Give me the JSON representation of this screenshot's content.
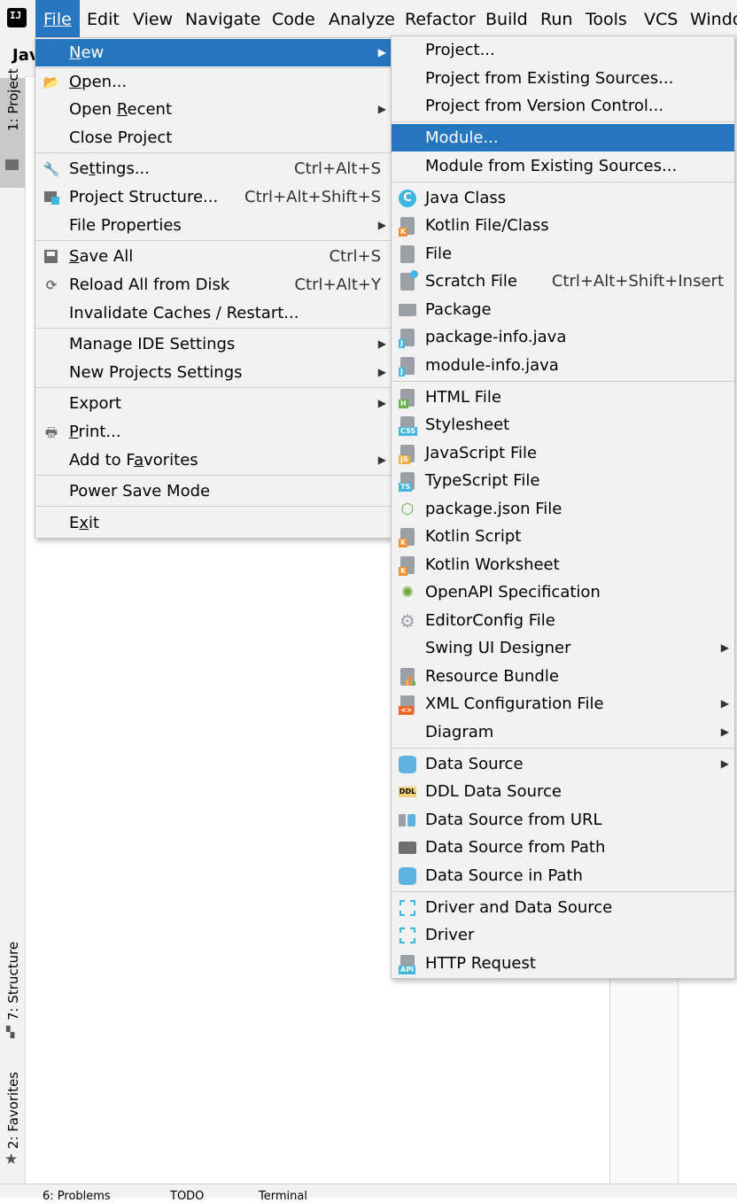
{
  "menubar": {
    "items": [
      "File",
      "Edit",
      "View",
      "Navigate",
      "Code",
      "Analyze",
      "Refactor",
      "Build",
      "Run",
      "Tools",
      "VCS",
      "Windo"
    ],
    "active": "File"
  },
  "toolbar": {
    "title": "Jav"
  },
  "left_stripe": {
    "project": "1: Project",
    "structure": "7: Structure",
    "favorites": "2: Favorites"
  },
  "bottom_bar": {
    "items": [
      "6: Problems",
      "TODO",
      "Terminal"
    ]
  },
  "file_menu": {
    "items": [
      {
        "label": "New",
        "submenu": true,
        "selected": true
      },
      {
        "label": "Open...",
        "icon": "folder-open-icon"
      },
      {
        "label": "Open Recent",
        "submenu": true
      },
      {
        "label": "Close Project"
      },
      {
        "label": "Settings...",
        "shortcut": "Ctrl+Alt+S",
        "icon": "wrench-icon"
      },
      {
        "label": "Project Structure...",
        "shortcut": "Ctrl+Alt+Shift+S",
        "icon": "project-structure-icon"
      },
      {
        "label": "File Properties",
        "submenu": true
      },
      {
        "label": "Save All",
        "shortcut": "Ctrl+S",
        "icon": "save-icon"
      },
      {
        "label": "Reload All from Disk",
        "shortcut": "Ctrl+Alt+Y",
        "icon": "reload-icon"
      },
      {
        "label": "Invalidate Caches / Restart..."
      },
      {
        "label": "Manage IDE Settings",
        "submenu": true
      },
      {
        "label": "New Projects Settings",
        "submenu": true
      },
      {
        "label": "Export",
        "submenu": true
      },
      {
        "label": "Print...",
        "icon": "printer-icon"
      },
      {
        "label": "Add to Favorites",
        "submenu": true
      },
      {
        "label": "Power Save Mode"
      },
      {
        "label": "Exit"
      }
    ]
  },
  "new_menu": {
    "items": [
      {
        "label": "Project..."
      },
      {
        "label": "Project from Existing Sources..."
      },
      {
        "label": "Project from Version Control..."
      },
      {
        "label": "Module...",
        "selected": true
      },
      {
        "label": "Module from Existing Sources..."
      },
      {
        "label": "Java Class",
        "icon": "java-class-icon"
      },
      {
        "label": "Kotlin File/Class",
        "icon": "kotlin-file-icon"
      },
      {
        "label": "File",
        "icon": "file-icon"
      },
      {
        "label": "Scratch File",
        "shortcut": "Ctrl+Alt+Shift+Insert",
        "icon": "scratch-file-icon"
      },
      {
        "label": "Package",
        "icon": "package-icon"
      },
      {
        "label": "package-info.java",
        "icon": "java-file-icon"
      },
      {
        "label": "module-info.java",
        "icon": "java-file-icon"
      },
      {
        "label": "HTML File",
        "icon": "html-file-icon"
      },
      {
        "label": "Stylesheet",
        "icon": "css-file-icon"
      },
      {
        "label": "JavaScript File",
        "icon": "js-file-icon"
      },
      {
        "label": "TypeScript File",
        "icon": "ts-file-icon"
      },
      {
        "label": "package.json File",
        "icon": "nodejs-icon"
      },
      {
        "label": "Kotlin Script",
        "icon": "kotlin-script-icon"
      },
      {
        "label": "Kotlin Worksheet",
        "icon": "kotlin-worksheet-icon"
      },
      {
        "label": "OpenAPI Specification",
        "icon": "openapi-icon"
      },
      {
        "label": "EditorConfig File",
        "icon": "gear-icon"
      },
      {
        "label": "Swing UI Designer",
        "submenu": true
      },
      {
        "label": "Resource Bundle",
        "icon": "resource-bundle-icon"
      },
      {
        "label": "XML Configuration File",
        "submenu": true,
        "icon": "xml-file-icon"
      },
      {
        "label": "Diagram",
        "submenu": true
      },
      {
        "label": "Data Source",
        "submenu": true,
        "icon": "database-icon"
      },
      {
        "label": "DDL Data Source",
        "icon": "ddl-icon"
      },
      {
        "label": "Data Source from URL",
        "icon": "datasource-url-icon"
      },
      {
        "label": "Data Source from Path",
        "icon": "folder-icon"
      },
      {
        "label": "Data Source in Path",
        "icon": "database-icon"
      },
      {
        "label": "Driver and Data Source",
        "icon": "driver-icon"
      },
      {
        "label": "Driver",
        "icon": "driver-icon"
      },
      {
        "label": "HTTP Request",
        "icon": "api-icon"
      }
    ]
  },
  "colors": {
    "selection": "#2675bf",
    "menu_bg": "#f2f2f2",
    "java_class": "#40b6e0"
  }
}
